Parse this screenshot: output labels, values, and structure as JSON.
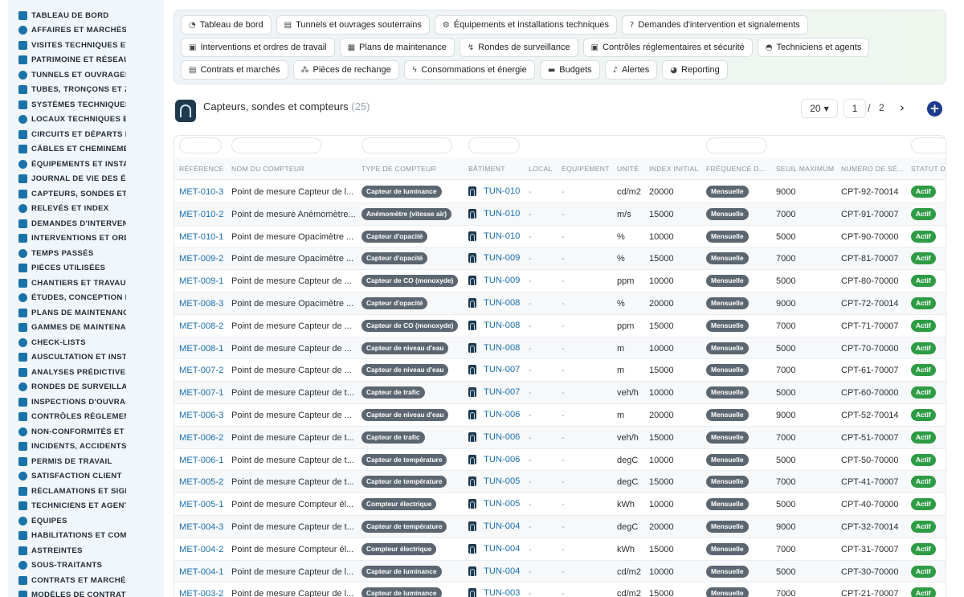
{
  "sidebar": {
    "items": [
      {
        "label": "TABLEAU DE BORD",
        "icon": "dashboard-icon"
      },
      {
        "label": "AFFAIRES ET MARCHÉS",
        "icon": "target-icon"
      },
      {
        "label": "VISITES TECHNIQUES ET",
        "icon": "path-icon"
      },
      {
        "label": "PATRIMOINE ET RÉSEAUX",
        "icon": "map-pin-icon"
      },
      {
        "label": "TUNNELS ET OUVRAGES",
        "icon": "document-icon"
      },
      {
        "label": "TUBES, TRONÇONS ET ZO",
        "icon": "book-icon"
      },
      {
        "label": "SYSTÈMES TECHNIQUES",
        "icon": "hierarchy-icon"
      },
      {
        "label": "LOCAUX TECHNIQUES ET",
        "icon": "grid-icon"
      },
      {
        "label": "CIRCUITS ET DÉPARTS ÉL",
        "icon": "list-icon"
      },
      {
        "label": "CÂBLES ET CHEMINEMEN",
        "icon": "cable-icon"
      },
      {
        "label": "ÉQUIPEMENTS ET INSTAL",
        "icon": "gears-icon"
      },
      {
        "label": "JOURNAL DE VIE DES ÉQ",
        "icon": "history-icon"
      },
      {
        "label": "CAPTEURS, SONDES ET C",
        "icon": "gauge-icon"
      },
      {
        "label": "RELEVÉS ET INDEX",
        "icon": "chart-icon"
      },
      {
        "label": "DEMANDES D'INTERVENT",
        "icon": "question-icon"
      },
      {
        "label": "INTERVENTIONS ET ORDI",
        "icon": "clipboard-icon"
      },
      {
        "label": "TEMPS PASSÉS",
        "icon": "clock-icon"
      },
      {
        "label": "PIÈCES UTILISÉES",
        "icon": "box-icon"
      },
      {
        "label": "CHANTIERS ET TRAVAUX",
        "icon": "hammer-icon"
      },
      {
        "label": "ÉTUDES, CONCEPTION ET",
        "icon": "pencil-icon"
      },
      {
        "label": "PLANS DE MAINTENANCE",
        "icon": "calendar-icon"
      },
      {
        "label": "GAMMES DE MAINTENAN",
        "icon": "layers-icon"
      },
      {
        "label": "CHECK-LISTS",
        "icon": "checklist-icon"
      },
      {
        "label": "AUSCULTATION ET INSTR",
        "icon": "pulse-icon"
      },
      {
        "label": "ANALYSES PRÉDICTIVES",
        "icon": "trend-icon"
      },
      {
        "label": "RONDES DE SURVEILLAN",
        "icon": "route-icon"
      },
      {
        "label": "INSPECTIONS D'OUVRAG",
        "icon": "search-icon"
      },
      {
        "label": "CONTRÔLES RÉGLEMENT",
        "icon": "clipboard-check-icon"
      },
      {
        "label": "NON-CONFORMITÉS ET A",
        "icon": "alert-icon"
      },
      {
        "label": "INCIDENTS, ACCIDENTS E",
        "icon": "warning-icon"
      },
      {
        "label": "PERMIS DE TRAVAIL",
        "icon": "file-icon"
      },
      {
        "label": "SATISFACTION CLIENT",
        "icon": "smile-icon"
      },
      {
        "label": "RÉCLAMATIONS ET SIGN.",
        "icon": "comment-icon"
      },
      {
        "label": "TECHNICIENS ET AGENTS",
        "icon": "helmet-icon"
      },
      {
        "label": "ÉQUIPES",
        "icon": "users-icon"
      },
      {
        "label": "HABILITATIONS ET COMP",
        "icon": "badge-icon"
      },
      {
        "label": "ASTREINTES",
        "icon": "phone-icon"
      },
      {
        "label": "SOUS-TRAITANTS",
        "icon": "handshake-icon"
      },
      {
        "label": "CONTRATS ET MARCHÉS",
        "icon": "contract-icon"
      },
      {
        "label": "MODÈLES DE CONTRATS",
        "icon": "template-icon"
      }
    ]
  },
  "nav": {
    "chips": [
      {
        "label": "Tableau de bord",
        "icon": "gauge-icon",
        "glyph": "◔"
      },
      {
        "label": "Tunnels et ouvrages souterrains",
        "icon": "document-icon",
        "glyph": "▤"
      },
      {
        "label": "Équipements et installations techniques",
        "icon": "gears-icon",
        "glyph": "⚙"
      },
      {
        "label": "Demandes d'intervention et signalements",
        "icon": "question-icon",
        "glyph": "?"
      },
      {
        "label": "Interventions et ordres de travail",
        "icon": "clipboard-icon",
        "glyph": "▣"
      },
      {
        "label": "Plans de maintenance",
        "icon": "calendar-icon",
        "glyph": "▦"
      },
      {
        "label": "Rondes de surveillance",
        "icon": "route-icon",
        "glyph": "↯"
      },
      {
        "label": "Contrôles réglementaires et sécurité",
        "icon": "clipboard-check-icon",
        "glyph": "▣"
      },
      {
        "label": "Techniciens et agents",
        "icon": "helmet-icon",
        "glyph": "◓"
      },
      {
        "label": "Contrats et marchés",
        "icon": "contract-icon",
        "glyph": "▤"
      },
      {
        "label": "Pièces de rechange",
        "icon": "hierarchy-icon",
        "glyph": "⁂"
      },
      {
        "label": "Consommations et énergie",
        "icon": "bolt-icon",
        "glyph": "ϟ"
      },
      {
        "label": "Budgets",
        "icon": "money-icon",
        "glyph": "▬"
      },
      {
        "label": "Alertes",
        "icon": "bell-icon",
        "glyph": "♪"
      },
      {
        "label": "Reporting",
        "icon": "pie-chart-icon",
        "glyph": "◕"
      }
    ]
  },
  "header": {
    "icon": "tunnel-icon",
    "title": "Capteurs, sondes et compteurs",
    "count": "(25)",
    "page_size": "20",
    "page_current": "1",
    "page_sep": "/",
    "page_total": "2",
    "next_glyph": "›",
    "add_glyph": "+"
  },
  "table": {
    "columns": [
      "RÉFÉRENCE",
      "NOM DU COMPTEUR",
      "TYPE DE COMPTEUR",
      "BÂTIMENT",
      "LOCAL",
      "ÉQUIPEMENT",
      "UNITÉ",
      "INDEX INITIAL",
      "FRÉQUENCE D...",
      "SEUIL MAXIMUM",
      "NUMÉRO DE SÉ...",
      "STATUT DU"
    ],
    "rows": [
      {
        "ref": "MET-010-3",
        "name": "Point de mesure Capteur de l...",
        "type": "Capteur de luminance",
        "bld": "TUN-010",
        "local": "-",
        "equip": "-",
        "unit": "cd/m2",
        "index": "20000",
        "freq": "Mensuelle",
        "seuil": "9000",
        "serial": "CPT-92-70014",
        "status": "Actif"
      },
      {
        "ref": "MET-010-2",
        "name": "Point de mesure Anémomètre...",
        "type": "Anémomètre (vitesse air)",
        "bld": "TUN-010",
        "local": "-",
        "equip": "-",
        "unit": "m/s",
        "index": "15000",
        "freq": "Mensuelle",
        "seuil": "7000",
        "serial": "CPT-91-70007",
        "status": "Actif"
      },
      {
        "ref": "MET-010-1",
        "name": "Point de mesure Opacimètre ...",
        "type": "Capteur d'opacité",
        "bld": "TUN-010",
        "local": "-",
        "equip": "-",
        "unit": "%",
        "index": "10000",
        "freq": "Mensuelle",
        "seuil": "5000",
        "serial": "CPT-90-70000",
        "status": "Actif"
      },
      {
        "ref": "MET-009-2",
        "name": "Point de mesure Opacimètre ...",
        "type": "Capteur d'opacité",
        "bld": "TUN-009",
        "local": "-",
        "equip": "-",
        "unit": "%",
        "index": "15000",
        "freq": "Mensuelle",
        "seuil": "7000",
        "serial": "CPT-81-70007",
        "status": "Actif"
      },
      {
        "ref": "MET-009-1",
        "name": "Point de mesure Capteur de ...",
        "type": "Capteur de CO (monoxyde)",
        "bld": "TUN-009",
        "local": "-",
        "equip": "-",
        "unit": "ppm",
        "index": "10000",
        "freq": "Mensuelle",
        "seuil": "5000",
        "serial": "CPT-80-70000",
        "status": "Actif"
      },
      {
        "ref": "MET-008-3",
        "name": "Point de mesure Opacimètre ...",
        "type": "Capteur d'opacité",
        "bld": "TUN-008",
        "local": "-",
        "equip": "-",
        "unit": "%",
        "index": "20000",
        "freq": "Mensuelle",
        "seuil": "9000",
        "serial": "CPT-72-70014",
        "status": "Actif"
      },
      {
        "ref": "MET-008-2",
        "name": "Point de mesure Capteur de ...",
        "type": "Capteur de CO (monoxyde)",
        "bld": "TUN-008",
        "local": "-",
        "equip": "-",
        "unit": "ppm",
        "index": "15000",
        "freq": "Mensuelle",
        "seuil": "7000",
        "serial": "CPT-71-70007",
        "status": "Actif"
      },
      {
        "ref": "MET-008-1",
        "name": "Point de mesure Capteur de ...",
        "type": "Capteur de niveau d'eau",
        "bld": "TUN-008",
        "local": "-",
        "equip": "-",
        "unit": "m",
        "index": "10000",
        "freq": "Mensuelle",
        "seuil": "5000",
        "serial": "CPT-70-70000",
        "status": "Actif"
      },
      {
        "ref": "MET-007-2",
        "name": "Point de mesure Capteur de ...",
        "type": "Capteur de niveau d'eau",
        "bld": "TUN-007",
        "local": "-",
        "equip": "-",
        "unit": "m",
        "index": "15000",
        "freq": "Mensuelle",
        "seuil": "7000",
        "serial": "CPT-61-70007",
        "status": "Actif"
      },
      {
        "ref": "MET-007-1",
        "name": "Point de mesure Capteur de t...",
        "type": "Capteur de trafic",
        "bld": "TUN-007",
        "local": "-",
        "equip": "-",
        "unit": "veh/h",
        "index": "10000",
        "freq": "Mensuelle",
        "seuil": "5000",
        "serial": "CPT-60-70000",
        "status": "Actif"
      },
      {
        "ref": "MET-006-3",
        "name": "Point de mesure Capteur de ...",
        "type": "Capteur de niveau d'eau",
        "bld": "TUN-006",
        "local": "-",
        "equip": "-",
        "unit": "m",
        "index": "20000",
        "freq": "Mensuelle",
        "seuil": "9000",
        "serial": "CPT-52-70014",
        "status": "Actif"
      },
      {
        "ref": "MET-006-2",
        "name": "Point de mesure Capteur de t...",
        "type": "Capteur de trafic",
        "bld": "TUN-006",
        "local": "-",
        "equip": "-",
        "unit": "veh/h",
        "index": "15000",
        "freq": "Mensuelle",
        "seuil": "7000",
        "serial": "CPT-51-70007",
        "status": "Actif"
      },
      {
        "ref": "MET-006-1",
        "name": "Point de mesure Capteur de t...",
        "type": "Capteur de température",
        "bld": "TUN-006",
        "local": "-",
        "equip": "-",
        "unit": "degC",
        "index": "10000",
        "freq": "Mensuelle",
        "seuil": "5000",
        "serial": "CPT-50-70000",
        "status": "Actif"
      },
      {
        "ref": "MET-005-2",
        "name": "Point de mesure Capteur de t...",
        "type": "Capteur de température",
        "bld": "TUN-005",
        "local": "-",
        "equip": "-",
        "unit": "degC",
        "index": "15000",
        "freq": "Mensuelle",
        "seuil": "7000",
        "serial": "CPT-41-70007",
        "status": "Actif"
      },
      {
        "ref": "MET-005-1",
        "name": "Point de mesure Compteur él...",
        "type": "Compteur électrique",
        "bld": "TUN-005",
        "local": "-",
        "equip": "-",
        "unit": "kWh",
        "index": "10000",
        "freq": "Mensuelle",
        "seuil": "5000",
        "serial": "CPT-40-70000",
        "status": "Actif"
      },
      {
        "ref": "MET-004-3",
        "name": "Point de mesure Capteur de t...",
        "type": "Capteur de température",
        "bld": "TUN-004",
        "local": "-",
        "equip": "-",
        "unit": "degC",
        "index": "20000",
        "freq": "Mensuelle",
        "seuil": "9000",
        "serial": "CPT-32-70014",
        "status": "Actif"
      },
      {
        "ref": "MET-004-2",
        "name": "Point de mesure Compteur él...",
        "type": "Compteur électrique",
        "bld": "TUN-004",
        "local": "-",
        "equip": "-",
        "unit": "kWh",
        "index": "15000",
        "freq": "Mensuelle",
        "seuil": "7000",
        "serial": "CPT-31-70007",
        "status": "Actif"
      },
      {
        "ref": "MET-004-1",
        "name": "Point de mesure Capteur de l...",
        "type": "Capteur de luminance",
        "bld": "TUN-004",
        "local": "-",
        "equip": "-",
        "unit": "cd/m2",
        "index": "10000",
        "freq": "Mensuelle",
        "seuil": "5000",
        "serial": "CPT-30-70000",
        "status": "Actif"
      },
      {
        "ref": "MET-003-2",
        "name": "Point de mesure Capteur de l...",
        "type": "Capteur de luminance",
        "bld": "TUN-003",
        "local": "-",
        "equip": "-",
        "unit": "cd/m2",
        "index": "15000",
        "freq": "Mensuelle",
        "seuil": "7000",
        "serial": "CPT-21-70007",
        "status": "Actif"
      }
    ]
  },
  "colors": {
    "accent": "#1a6fb0",
    "badge_grey": "#5b6670",
    "badge_active": "#2e9c44",
    "add_button": "#1b3c8c",
    "sidebar_bg": "#f1f6fa",
    "sidebar_icon": "#1a73a8"
  }
}
